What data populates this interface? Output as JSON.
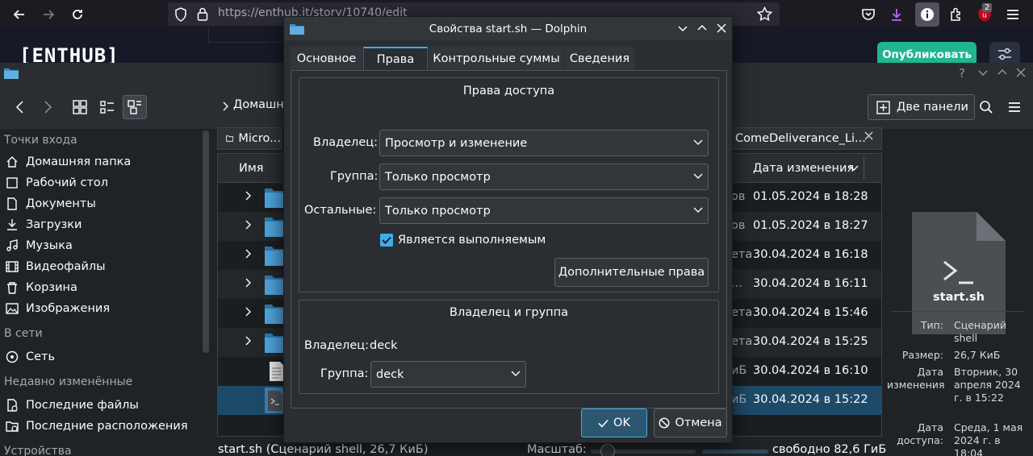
{
  "browser": {
    "url": "https://enthub.it/story/10740/edit",
    "badge_count": "2"
  },
  "webpage": {
    "logo": "[ENTHUB]",
    "publish_label": "Опубликовать"
  },
  "dolphin": {
    "help_glyph": "?",
    "breadcrumb": "Домашн",
    "two_panels_label": "Две панели",
    "places": {
      "header_entry": "Точки входа",
      "items": [
        "Домашняя папка",
        "Рабочий стол",
        "Документы",
        "Загрузки",
        "Музыка",
        "Видеофайлы",
        "Корзина",
        "Изображения"
      ],
      "header_network": "В сети",
      "network_items": [
        "Сеть"
      ],
      "header_recent": "Недавно изменённые",
      "recent_items": [
        "Последние файлы",
        "Последние расположения"
      ],
      "header_devices": "Устройства"
    },
    "tabs": {
      "left": "Micro...",
      "right": "ComeDeliverance_Li..."
    },
    "columns": {
      "name": "Имя",
      "date": "Дата изменения"
    },
    "rows": [
      {
        "frag": "ов",
        "date": "01.05.2024 в 18:28"
      },
      {
        "frag": "ов",
        "date": "01.05.2024 в 18:27"
      },
      {
        "frag": "ета",
        "date": "30.04.2024 в 16:18"
      },
      {
        "frag": "...",
        "date": "30.04.2024 в 16:11"
      },
      {
        "frag": "ета",
        "date": "30.04.2024 в 15:46"
      },
      {
        "frag": "ета",
        "date": "30.04.2024 в 15:25"
      },
      {
        "frag": "иБ",
        "date": "30.04.2024 в 16:10"
      },
      {
        "frag": "иБ",
        "date": "30.04.2024 в 15:22"
      }
    ],
    "status": "start.sh (Сценарий shell, 26,7 КиБ)",
    "zoom_label": "Масштаб:",
    "free_space": "свободно 82,6 ГиБ",
    "info": {
      "filename": "start.sh",
      "type_key": "Тип:",
      "type_val": "Сценарий shell",
      "size_key": "Размер:",
      "size_val": "26,7 КиБ",
      "modified_key": "Дата изменения",
      "modified_val": "Вторник, 30 апреля 2024 г. в 15:22",
      "accessed_key": "Дата доступа:",
      "accessed_val": "Среда, 1 мая 2024 г. в 18:04"
    }
  },
  "dialog": {
    "title": "Свойства start.sh — Dolphin",
    "tabs": [
      "Основное",
      "Права",
      "Контрольные суммы",
      "Сведения"
    ],
    "access_group_title": "Права доступа",
    "owner_label": "Владелец:",
    "owner_value": "Просмотр и изменение",
    "group_label": "Группа:",
    "group_value": "Только просмотр",
    "others_label": "Остальные:",
    "others_value": "Только просмотр",
    "executable_label": "Является выполняемым",
    "advanced_button": "Дополнительные права",
    "ownership_title": "Владелец и группа",
    "ownership_owner_label": "Владелец:",
    "ownership_owner_value": "deck",
    "ownership_group_label": "Группа:",
    "ownership_group_value": "deck",
    "ok_label": "OK",
    "cancel_label": "Отмена"
  }
}
